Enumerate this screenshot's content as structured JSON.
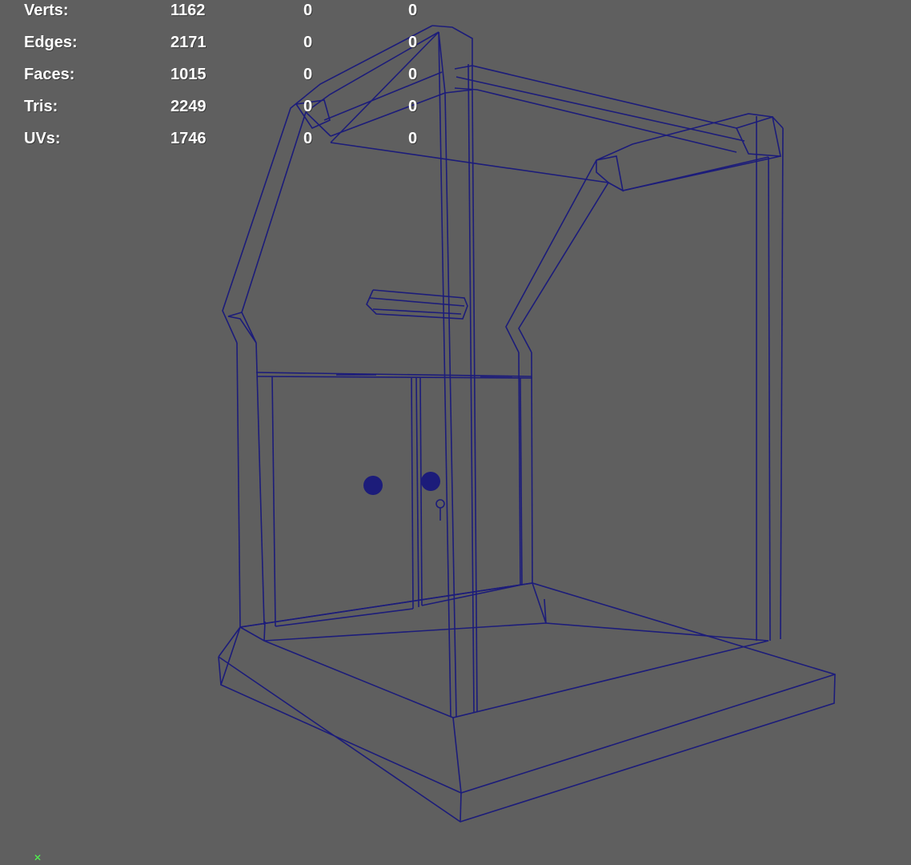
{
  "hud": {
    "rows": [
      {
        "label": "Verts:",
        "total": "1162",
        "selected": "0",
        "component": "0"
      },
      {
        "label": "Edges:",
        "total": "2171",
        "selected": "0",
        "component": "0"
      },
      {
        "label": "Faces:",
        "total": "1015",
        "selected": "0",
        "component": "0"
      },
      {
        "label": "Tris:",
        "total": "2249",
        "selected": "0",
        "component": "0"
      },
      {
        "label": "UVs:",
        "total": "1746",
        "selected": "0",
        "component": "0"
      }
    ]
  },
  "colors": {
    "viewport_background": "#5f5f5f",
    "wireframe": "#1c1c7a",
    "hud_text": "#ffffff",
    "axis_indicator": "#4dff4d"
  },
  "viewport": {
    "display_mode": "wireframe",
    "model": "wooden-booth-with-double-doors"
  }
}
